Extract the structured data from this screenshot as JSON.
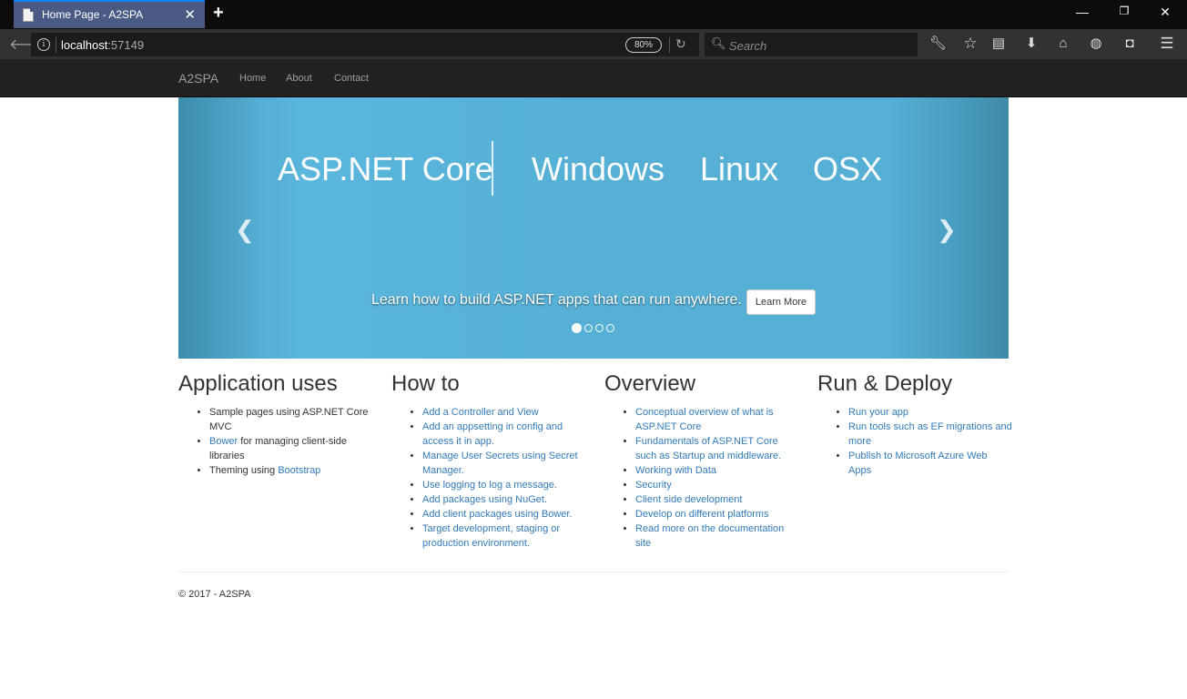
{
  "browser": {
    "tab_title": "Home Page - A2SPA",
    "url_host": "localhost",
    "url_port": ":57149",
    "zoom": "80%",
    "search_placeholder": "Search"
  },
  "site": {
    "brand": "A2SPA",
    "nav": [
      "Home",
      "About",
      "Contact"
    ]
  },
  "carousel": {
    "headline": "ASP.NET Core",
    "words": [
      "Windows",
      "Linux",
      "OSX"
    ],
    "caption": "Learn how to build ASP.NET apps that can run anywhere.",
    "button": "Learn More",
    "slide_count": 4,
    "active_slide": 1
  },
  "columns": [
    {
      "title": "Application uses",
      "items": [
        {
          "pre": "Sample pages using ASP.NET Core MVC",
          "link": "",
          "post": ""
        },
        {
          "pre": "",
          "link": "Bower",
          "post": " for managing client-side libraries"
        },
        {
          "pre": "Theming using ",
          "link": "Bootstrap",
          "post": ""
        }
      ]
    },
    {
      "title": "How to",
      "items": [
        "Add a Controller and View",
        "Add an appsetting in config and access it in app.",
        "Manage User Secrets using Secret Manager.",
        "Use logging to log a message.",
        "Add packages using NuGet.",
        "Add client packages using Bower.",
        "Target development, staging or production environment."
      ]
    },
    {
      "title": "Overview",
      "items": [
        "Conceptual overview of what is ASP.NET Core",
        "Fundamentals of ASP.NET Core such as Startup and middleware.",
        "Working with Data",
        "Security",
        "Client side development",
        "Develop on different platforms",
        "Read more on the documentation site"
      ]
    },
    {
      "title": "Run & Deploy",
      "items": [
        "Run your app",
        "Run tools such as EF migrations and more",
        "Publish to Microsoft Azure Web Apps"
      ]
    }
  ],
  "footer": "© 2017 - A2SPA",
  "colors": {
    "link": "#337ab7",
    "navbar": "#222222",
    "carousel": "#56b0d6"
  }
}
